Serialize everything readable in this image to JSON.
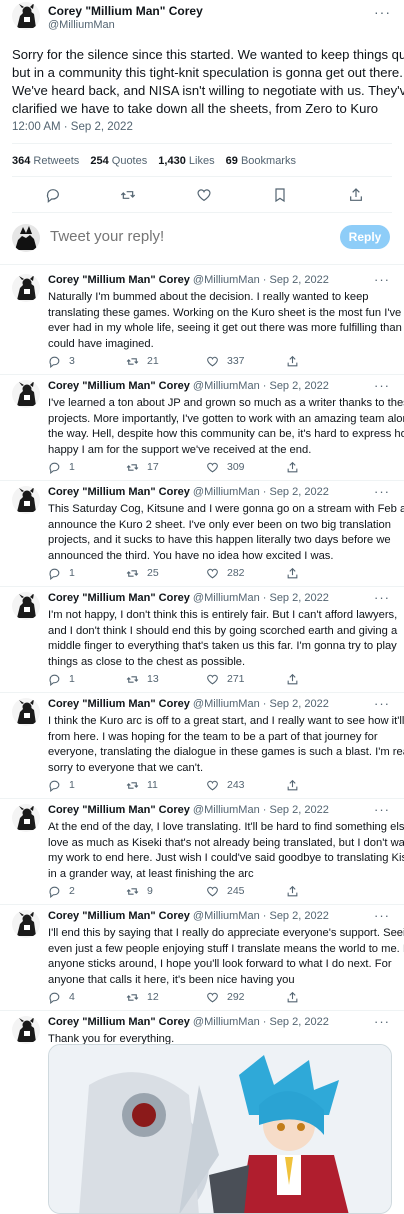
{
  "main_tweet": {
    "author_name": "Corey \"Millium Man\" Corey",
    "handle": "@MilliumMan",
    "more": "···",
    "lines": [
      "Sorry for the silence since this started. We wanted to keep things quiet,",
      "but in a community this tight-knit speculation is gonna get out there.",
      "We've heard back, and NISA isn't willing to negotiate with us. They've",
      "clarified we have to take down all the sheets, from Zero to Kuro"
    ],
    "timestamp": "12:00 AM · Sep 2, 2022",
    "stats": [
      {
        "count": "364",
        "label": "Retweets"
      },
      {
        "count": "254",
        "label": "Quotes"
      },
      {
        "count": "1,430",
        "label": "Likes"
      },
      {
        "count": "69",
        "label": "Bookmarks"
      }
    ]
  },
  "reply_box": {
    "placeholder": "Tweet your reply!",
    "button": "Reply"
  },
  "replies": [
    {
      "name": "Corey \"Millium Man\" Corey",
      "meta": "@MilliumMan · Sep 2, 2022",
      "lines": [
        "Naturally I'm bummed about the decision. I really wanted to keep",
        "translating these games. Working on the Kuro sheet is the most fun I've",
        "ever had in my whole life, seeing it get out there was more fulfilling than I",
        "could have imagined."
      ],
      "replies": "3",
      "retweets": "21",
      "likes": "337"
    },
    {
      "name": "Corey \"Millium Man\" Corey",
      "meta": "@MilliumMan · Sep 2, 2022",
      "lines": [
        "I've learned a ton about JP and grown so much as a writer thanks to these",
        "projects. More importantly, I've gotten to work with an amazing team along",
        "the way. Hell, despite how this community can be, it's hard to express how",
        "happy I am for the support we've received at the end."
      ],
      "replies": "1",
      "retweets": "17",
      "likes": "309"
    },
    {
      "name": "Corey \"Millium Man\" Corey",
      "meta": "@MilliumMan · Sep 2, 2022",
      "lines": [
        "This Saturday Cog, Kitsune and I were gonna go on a stream with Feb and",
        "announce the Kuro 2 sheet. I've only ever been on two big translation",
        "projects, and it sucks to have this happen literally two days before we",
        "announced the third. You have no idea how excited I was."
      ],
      "replies": "1",
      "retweets": "25",
      "likes": "282"
    },
    {
      "name": "Corey \"Millium Man\" Corey",
      "meta": "@MilliumMan · Sep 2, 2022",
      "lines": [
        "I'm not happy, I don't think this is entirely fair. But I  can't afford lawyers,",
        "and I don't think I should end this by going scorched earth and giving a",
        "middle finger to everything that's taken us this far. I'm gonna try to play",
        "things as close to the chest as possible."
      ],
      "replies": "1",
      "retweets": "13",
      "likes": "271"
    },
    {
      "name": "Corey \"Millium Man\" Corey",
      "meta": "@MilliumMan · Sep 2, 2022",
      "lines": [
        "I think the Kuro arc is off to a great start, and I really want to see how it'll go",
        "from here. I was hoping for the team to be a part of that journey for",
        "everyone, translating the dialogue in these games is such a blast. I'm really",
        "sorry to everyone that we can't."
      ],
      "replies": "1",
      "retweets": "11",
      "likes": "243"
    },
    {
      "name": "Corey \"Millium Man\" Corey",
      "meta": "@MilliumMan · Sep 2, 2022",
      "lines": [
        "At the end of the day, I love translating. It'll be hard to find something else I",
        "love as much as Kiseki that's not already being translated, but I don't want",
        "my work to end here. Just wish I could've said goodbye to translating Kiseki",
        "in a grander way, at least finishing the arc"
      ],
      "replies": "2",
      "retweets": "9",
      "likes": "245"
    },
    {
      "name": "Corey \"Millium Man\" Corey",
      "meta": "@MilliumMan · Sep 2, 2022",
      "lines": [
        "I'll end this by saying that I really do appreciate everyone's support. Seeing",
        "even just a few people enjoying stuff I translate means the world to me. If",
        "anyone sticks around, I hope you'll look forward to what I do next. For",
        "anyone that calls it here, it's been nice having you"
      ],
      "replies": "4",
      "retweets": "12",
      "likes": "292"
    },
    {
      "name": "Corey \"Millium Man\" Corey",
      "meta": "@MilliumMan · Sep 2, 2022",
      "lines": [
        "Thank you for everything."
      ]
    }
  ],
  "icons": {
    "reply": "comment-icon",
    "retweet": "retweet-icon",
    "like": "heart-icon",
    "share": "share-icon",
    "bookmark": "bookmark-icon"
  },
  "colors": {
    "text": "#0f1419",
    "muted": "#536471",
    "reply_button": "#8ecdf8",
    "divider": "#eff3f4"
  }
}
